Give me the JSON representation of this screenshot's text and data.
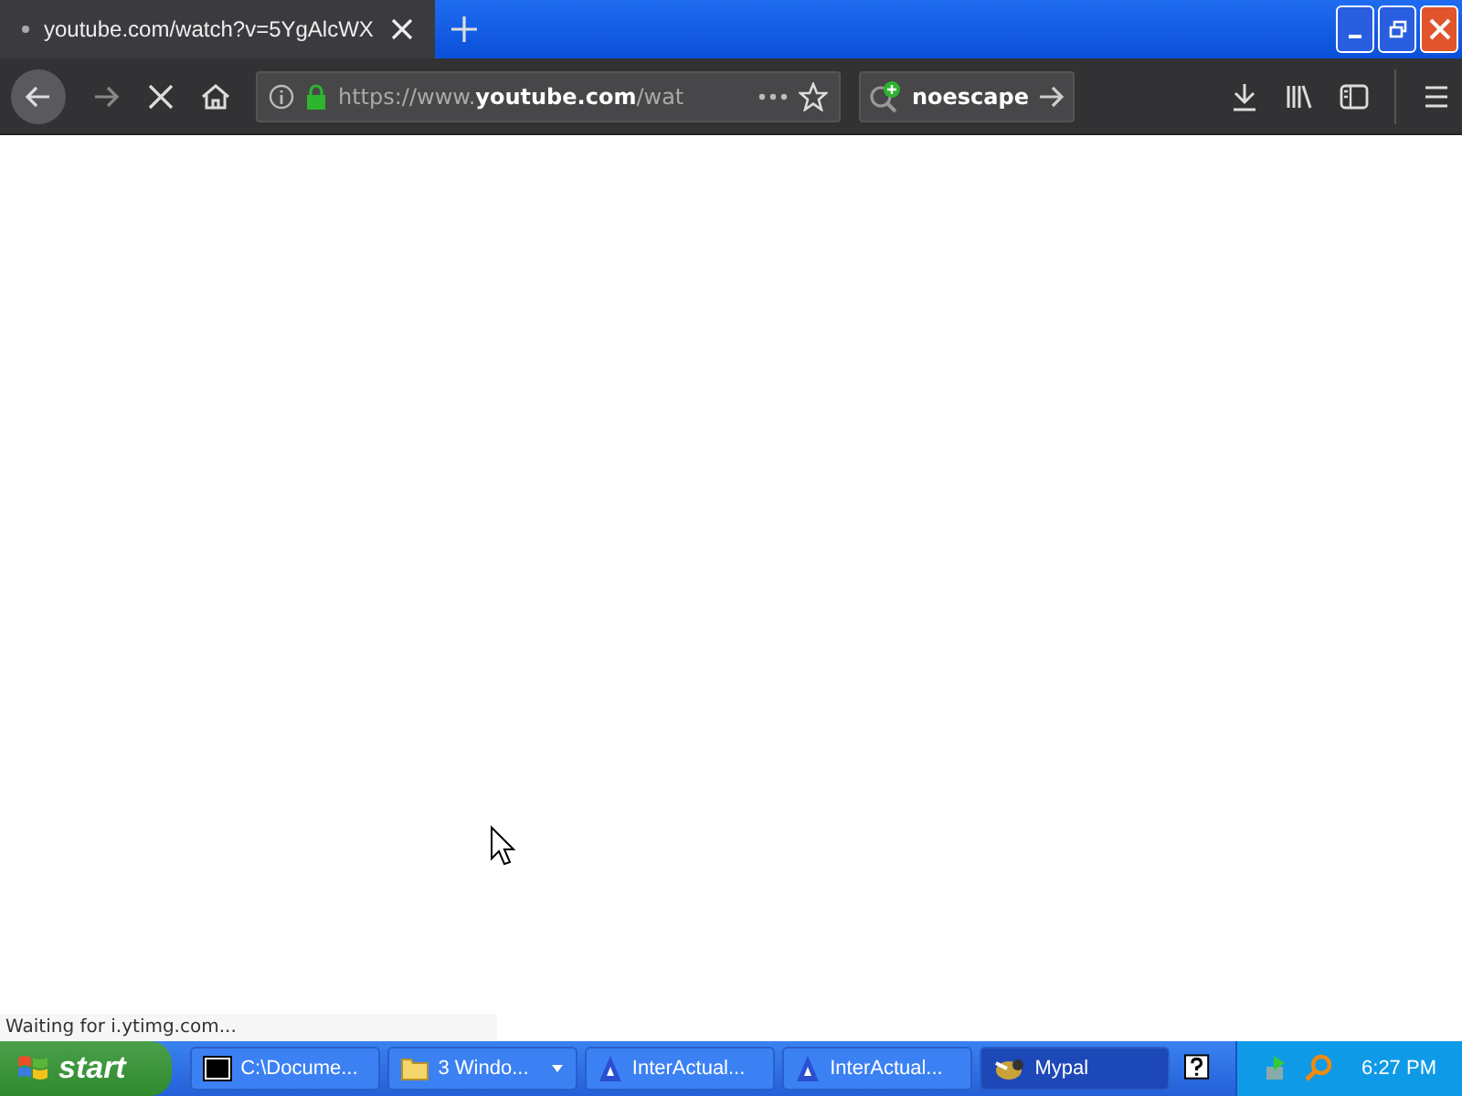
{
  "tab": {
    "title": "youtube.com/watch?v=5YgAlcWX",
    "loading": true
  },
  "toolbar": {
    "url": "https://www.**youtube.com**/wat",
    "search_engine": "noescape"
  },
  "status_bar": {
    "text": "Waiting for i.ytimg.com..."
  },
  "taskbar": {
    "start": "start",
    "items": [
      {
        "kind": "console",
        "label": "C:\\Docume...",
        "selected": false,
        "grouped": false
      },
      {
        "kind": "folder",
        "label": "3 Windo...",
        "selected": false,
        "grouped": true
      },
      {
        "kind": "media",
        "label": "InterActual...",
        "selected": false,
        "grouped": false
      },
      {
        "kind": "media",
        "label": "InterActual...",
        "selected": false,
        "grouped": false
      },
      {
        "kind": "browser",
        "label": "Mypal",
        "selected": true,
        "grouped": false
      }
    ],
    "clock": "6:27 PM"
  }
}
